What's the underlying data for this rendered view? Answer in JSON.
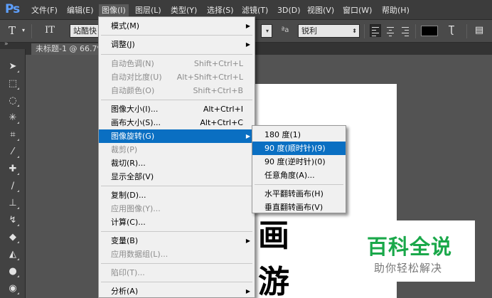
{
  "menubar": {
    "logo": "Ps",
    "items": [
      "文件(F)",
      "编辑(E)",
      "图像(I)",
      "图层(L)",
      "类型(Y)",
      "选择(S)",
      "滤镜(T)",
      "3D(D)",
      "视图(V)",
      "窗口(W)",
      "帮助(H)"
    ]
  },
  "options": {
    "type_tool_glyph": "T",
    "orient_glyph": "IT",
    "font_family": "站酷快",
    "aa_label": "ªa",
    "anti_alias": "锐利",
    "text_color": "#000000"
  },
  "document": {
    "tab_label": "未标题-1 @ 66.7%"
  },
  "canvas_text": {
    "line1": "画",
    "line2": "游"
  },
  "watermark": {
    "title": "百科全说",
    "subtitle": "助你轻松解决"
  },
  "image_menu": {
    "items": [
      {
        "label": "模式(M)"
      },
      {
        "label": "调整(J)"
      },
      {
        "label": "自动色调(N)",
        "shortcut": "Shift+Ctrl+L"
      },
      {
        "label": "自动对比度(U)",
        "shortcut": "Alt+Shift+Ctrl+L"
      },
      {
        "label": "自动颜色(O)",
        "shortcut": "Shift+Ctrl+B"
      },
      {
        "label": "图像大小(I)...",
        "shortcut": "Alt+Ctrl+I"
      },
      {
        "label": "画布大小(S)...",
        "shortcut": "Alt+Ctrl+C"
      },
      {
        "label": "图像旋转(G)"
      },
      {
        "label": "裁剪(P)"
      },
      {
        "label": "裁切(R)..."
      },
      {
        "label": "显示全部(V)"
      },
      {
        "label": "复制(D)..."
      },
      {
        "label": "应用图像(Y)..."
      },
      {
        "label": "计算(C)..."
      },
      {
        "label": "变量(B)"
      },
      {
        "label": "应用数据组(L)..."
      },
      {
        "label": "陷印(T)..."
      },
      {
        "label": "分析(A)"
      }
    ]
  },
  "rotate_menu": {
    "items": [
      {
        "label": "180 度(1)"
      },
      {
        "label": "90 度(顺时针)(9)"
      },
      {
        "label": "90 度(逆时针)(0)"
      },
      {
        "label": "任意角度(A)..."
      },
      {
        "label": "水平翻转画布(H)"
      },
      {
        "label": "垂直翻转画布(V)"
      }
    ]
  },
  "colors": {
    "menu_highlight": "#0a6fc2",
    "watermark_green": "#1aa84a"
  }
}
